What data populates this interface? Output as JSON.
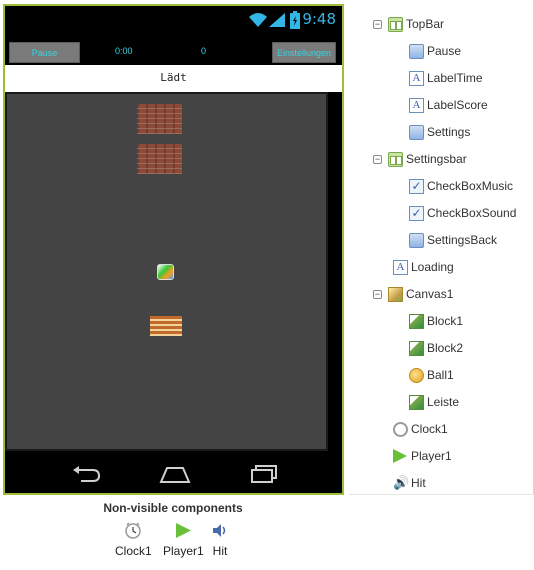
{
  "phone": {
    "status_time": "9:48",
    "pause_label": "Pause",
    "time_label": "0:00",
    "score_label": "0",
    "settings_label": "Einstellungen",
    "loading_text": "Lädt"
  },
  "nonvisible": {
    "title": "Non-visible components",
    "items": [
      {
        "label": "Clock1",
        "icon": "clock-icon"
      },
      {
        "label": "Player1",
        "icon": "player-icon"
      },
      {
        "label": "Hit",
        "icon": "sound-icon"
      }
    ]
  },
  "tree": {
    "items": [
      {
        "label": "TopBar",
        "icon": "arrangement-icon",
        "toggle": "⊖"
      },
      {
        "label": "Pause",
        "icon": "button-icon"
      },
      {
        "label": "LabelTime",
        "icon": "label-icon"
      },
      {
        "label": "LabelScore",
        "icon": "label-icon"
      },
      {
        "label": "Settings",
        "icon": "button-icon"
      },
      {
        "label": "Settingsbar",
        "icon": "arrangement-icon",
        "toggle": "⊖"
      },
      {
        "label": "CheckBoxMusic",
        "icon": "checkbox-icon"
      },
      {
        "label": "CheckBoxSound",
        "icon": "checkbox-icon"
      },
      {
        "label": "SettingsBack",
        "icon": "button-icon"
      },
      {
        "label": "Loading",
        "icon": "label-icon"
      },
      {
        "label": "Canvas1",
        "icon": "canvas-icon",
        "toggle": "⊖"
      },
      {
        "label": "Block1",
        "icon": "sprite-icon"
      },
      {
        "label": "Block2",
        "icon": "sprite-icon"
      },
      {
        "label": "Ball1",
        "icon": "ball-icon"
      },
      {
        "label": "Leiste",
        "icon": "sprite-icon"
      },
      {
        "label": "Clock1",
        "icon": "clock-icon"
      },
      {
        "label": "Player1",
        "icon": "player-icon"
      },
      {
        "label": "Hit",
        "icon": "sound-icon"
      }
    ]
  },
  "colors": {
    "accent_cyan": "#33d6e5",
    "phone_border": "#9cbe3a",
    "canvas_bg": "#444444"
  }
}
